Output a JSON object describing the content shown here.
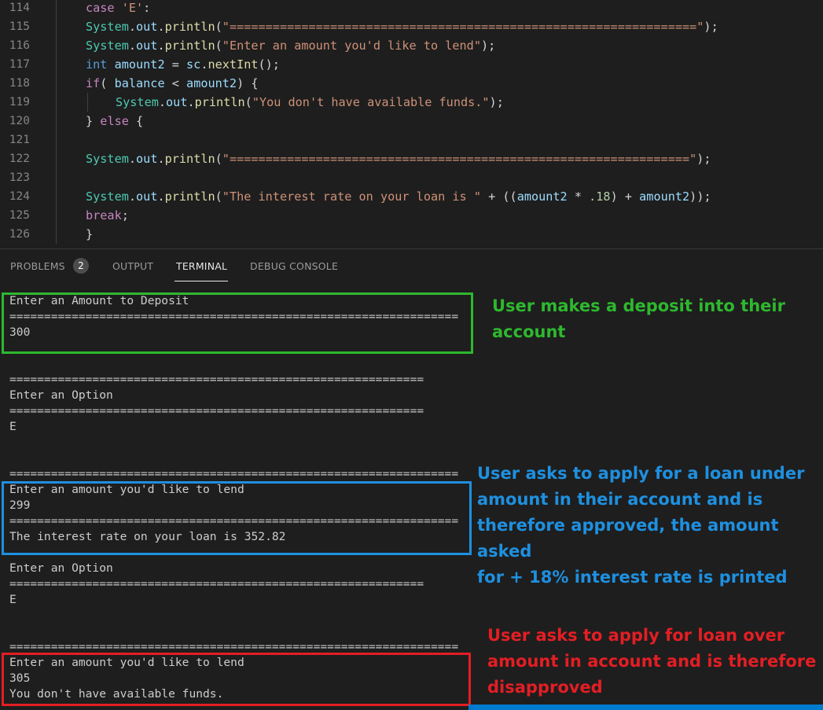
{
  "editor": {
    "lines": [
      {
        "n": "114",
        "indent": 1,
        "tokens": [
          [
            "kw",
            "case "
          ],
          [
            "str",
            "'E'"
          ],
          [
            "op",
            ":"
          ]
        ]
      },
      {
        "n": "115",
        "indent": 1,
        "tokens": [
          [
            "cls",
            "System"
          ],
          [
            "op",
            "."
          ],
          [
            "vr",
            "out"
          ],
          [
            "op",
            "."
          ],
          [
            "fn",
            "println"
          ],
          [
            "op",
            "("
          ],
          [
            "str",
            "\"=================================================================\""
          ],
          [
            "op",
            ");"
          ]
        ]
      },
      {
        "n": "116",
        "indent": 1,
        "tokens": [
          [
            "cls",
            "System"
          ],
          [
            "op",
            "."
          ],
          [
            "vr",
            "out"
          ],
          [
            "op",
            "."
          ],
          [
            "fn",
            "println"
          ],
          [
            "op",
            "("
          ],
          [
            "str",
            "\"Enter an amount you'd like to lend\""
          ],
          [
            "op",
            ");"
          ]
        ]
      },
      {
        "n": "117",
        "indent": 1,
        "tokens": [
          [
            "ty",
            "int "
          ],
          [
            "vr",
            "amount2"
          ],
          [
            "op",
            " = "
          ],
          [
            "vr",
            "sc"
          ],
          [
            "op",
            "."
          ],
          [
            "fn",
            "nextInt"
          ],
          [
            "op",
            "();"
          ]
        ]
      },
      {
        "n": "118",
        "indent": 1,
        "tokens": [
          [
            "kw",
            "if"
          ],
          [
            "op",
            "( "
          ],
          [
            "vr",
            "balance"
          ],
          [
            "op",
            " < "
          ],
          [
            "vr",
            "amount2"
          ],
          [
            "op",
            ") {"
          ]
        ]
      },
      {
        "n": "119",
        "indent": 2,
        "tokens": [
          [
            "cls",
            "System"
          ],
          [
            "op",
            "."
          ],
          [
            "vr",
            "out"
          ],
          [
            "op",
            "."
          ],
          [
            "fn",
            "println"
          ],
          [
            "op",
            "("
          ],
          [
            "str",
            "\"You don't have available funds.\""
          ],
          [
            "op",
            ");"
          ]
        ]
      },
      {
        "n": "120",
        "indent": 1,
        "tokens": [
          [
            "op",
            "} "
          ],
          [
            "kw",
            "else"
          ],
          [
            "op",
            " {"
          ]
        ]
      },
      {
        "n": "121",
        "indent": 1,
        "tokens": []
      },
      {
        "n": "122",
        "indent": 1,
        "tokens": [
          [
            "cls",
            "System"
          ],
          [
            "op",
            "."
          ],
          [
            "vr",
            "out"
          ],
          [
            "op",
            "."
          ],
          [
            "fn",
            "println"
          ],
          [
            "op",
            "("
          ],
          [
            "str",
            "\"================================================================\""
          ],
          [
            "op",
            ");"
          ]
        ]
      },
      {
        "n": "123",
        "indent": 1,
        "tokens": []
      },
      {
        "n": "124",
        "indent": 1,
        "tokens": [
          [
            "cls",
            "System"
          ],
          [
            "op",
            "."
          ],
          [
            "vr",
            "out"
          ],
          [
            "op",
            "."
          ],
          [
            "fn",
            "println"
          ],
          [
            "op",
            "("
          ],
          [
            "str",
            "\"The interest rate on your loan is \""
          ],
          [
            "op",
            " + (("
          ],
          [
            "vr",
            "amount2"
          ],
          [
            "op",
            " * "
          ],
          [
            "num",
            ".18"
          ],
          [
            "op",
            ") + "
          ],
          [
            "vr",
            "amount2"
          ],
          [
            "op",
            "));"
          ]
        ]
      },
      {
        "n": "125",
        "indent": 1,
        "tokens": [
          [
            "kw",
            "break"
          ],
          [
            "op",
            ";"
          ]
        ]
      },
      {
        "n": "126",
        "indent": 1,
        "tokens": [
          [
            "op",
            "}"
          ]
        ]
      }
    ]
  },
  "panel": {
    "tabs": [
      {
        "label": "PROBLEMS",
        "badge": "2"
      },
      {
        "label": "OUTPUT"
      },
      {
        "label": "TERMINAL",
        "active": true
      },
      {
        "label": "DEBUG CONSOLE"
      }
    ]
  },
  "terminal": {
    "lines": [
      "Enter an Amount to Deposit",
      "=================================================================",
      "300",
      "",
      "",
      "============================================================",
      "Enter an Option",
      "============================================================",
      "E",
      "",
      "",
      "=================================================================",
      "Enter an amount you'd like to lend",
      "299",
      "=================================================================",
      "The interest rate on your loan is 352.82",
      "",
      "Enter an Option",
      "============================================================",
      "E",
      "",
      "",
      "=================================================================",
      "Enter an amount you'd like to lend",
      "305",
      "You don't have available funds."
    ]
  },
  "annotations": [
    {
      "lines": [
        "User makes a deposit into their",
        "account"
      ],
      "color": "#2eb82e"
    },
    {
      "lines": [
        "User asks to apply for a loan under",
        "amount in their account and is",
        "therefore approved, the amount asked",
        "for + 18% interest rate is printed"
      ],
      "color": "#1e90e0"
    },
    {
      "lines": [
        "User asks to apply for loan over",
        "amount in account and is therefore",
        "disapproved"
      ],
      "color": "#e31e24"
    }
  ],
  "colors": {
    "accent_blue": "#007acc",
    "box_green": "#2eb82e",
    "box_blue": "#1e90e0",
    "box_red": "#e31e24"
  }
}
